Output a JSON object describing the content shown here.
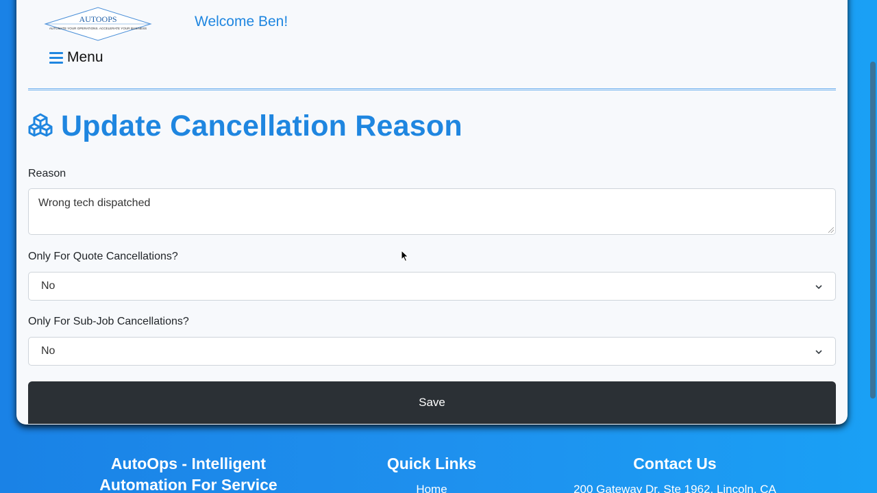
{
  "header": {
    "logo_text": "AUTOOPS",
    "logo_tagline": "AUTOMATE YOUR OPERATIONS. ACCELERATE YOUR BUSINESS",
    "welcome": "Welcome Ben!",
    "menu_label": "Menu"
  },
  "page": {
    "title": "Update Cancellation Reason",
    "title_icon": "cubes-icon"
  },
  "form": {
    "reason_label": "Reason",
    "reason_value": "Wrong tech dispatched",
    "quote_label": "Only For Quote Cancellations?",
    "quote_value": "No",
    "subjob_label": "Only For Sub-Job Cancellations?",
    "subjob_value": "No",
    "save_label": "Save"
  },
  "footer": {
    "about_title": "AutoOps - Intelligent Automation For Service",
    "links_title": "Quick Links",
    "links_first": "Home",
    "contact_title": "Contact Us",
    "contact_address": "200 Gateway Dr, Ste 1962, Lincoln, CA"
  },
  "colors": {
    "accent": "#1f86e0",
    "save_bg": "#2b3035",
    "background": "#1e90ee"
  }
}
